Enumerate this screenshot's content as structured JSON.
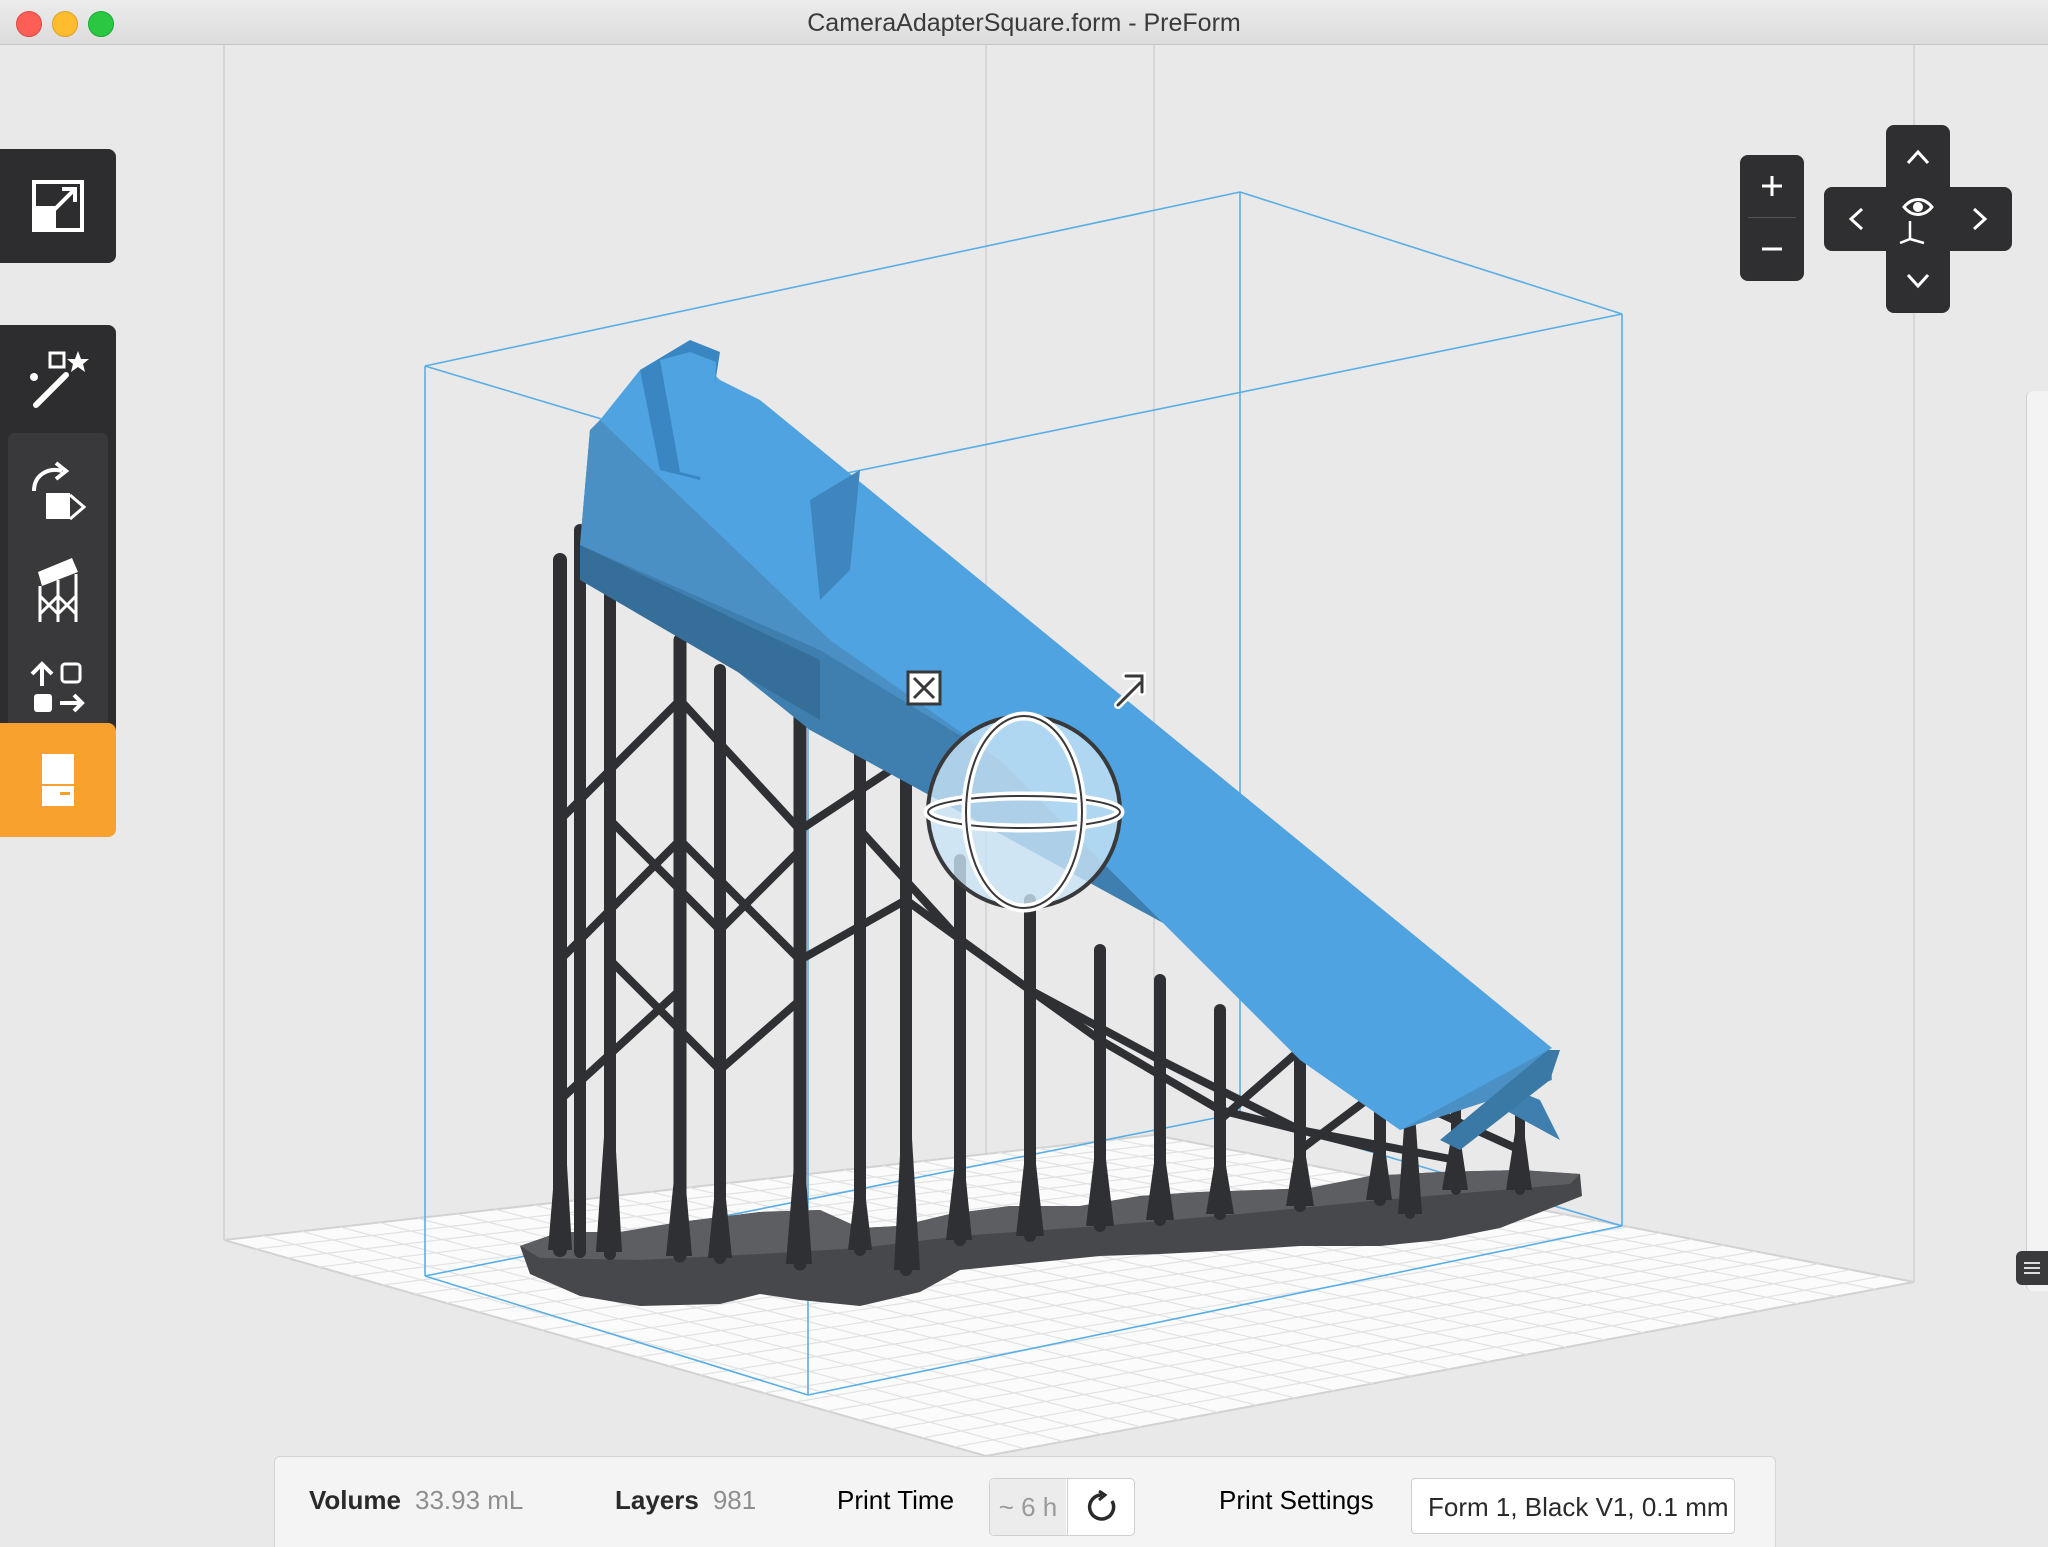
{
  "window": {
    "title": "CameraAdapterSquare.form - PreForm"
  },
  "toolbar": {
    "tools": [
      {
        "name": "Open / Import",
        "icon": "scale-resize-icon"
      },
      {
        "name": "One-Click Print",
        "icon": "magic-wand-icon"
      },
      {
        "name": "Orientation",
        "icon": "rotate-orientation-icon"
      },
      {
        "name": "Supports",
        "icon": "supports-icon"
      },
      {
        "name": "Layout",
        "icon": "layout-arrange-icon"
      },
      {
        "name": "Print",
        "icon": "print-icon",
        "active": true,
        "active_color": "#f8a12e"
      }
    ]
  },
  "view_controls": {
    "zoom_in": "+",
    "zoom_out": "−",
    "pan_up": "^",
    "pan_down": "v",
    "pan_left": "<",
    "pan_right": ">"
  },
  "status": {
    "volume_label": "Volume",
    "volume_value": "33.93 mL",
    "layers_label": "Layers",
    "layers_value": "981",
    "print_time_label": "Print Time",
    "print_time_value": "~ 6 h",
    "print_settings_label": "Print Settings",
    "print_settings_value": "Form 1, Black V1, 0.1 mm"
  },
  "colors": {
    "model_blue": "#4ea3e0",
    "build_volume_line": "#59aee6",
    "support_dark": "#2f3033",
    "accent_orange": "#f8a12e"
  }
}
